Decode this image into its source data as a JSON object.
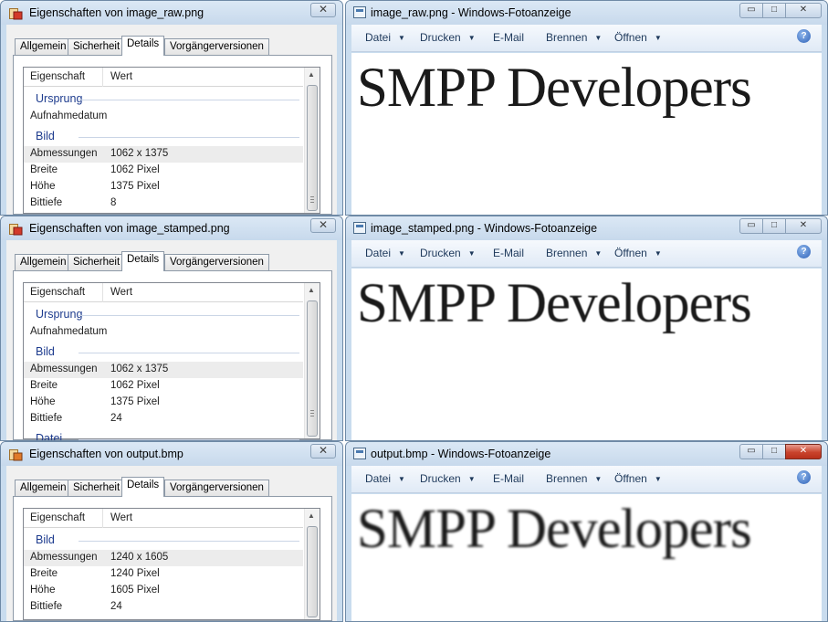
{
  "properties_windows": [
    {
      "title": "Eigenschaften von image_raw.png",
      "close_label": "✕",
      "tabs": [
        "Allgemein",
        "Sicherheit",
        "Details",
        "Vorgängerversionen"
      ],
      "active_tab": "Details",
      "columns": [
        "Eigenschaft",
        "Wert"
      ],
      "groups": [
        {
          "name": "Ursprung",
          "rows": [
            {
              "key": "Aufnahmedatum",
              "value": ""
            }
          ]
        },
        {
          "name": "Bild",
          "rows": [
            {
              "key": "Abmessungen",
              "value": "1062 x 1375"
            },
            {
              "key": "Breite",
              "value": "1062 Pixel"
            },
            {
              "key": "Höhe",
              "value": "1375 Pixel"
            },
            {
              "key": "Bittiefe",
              "value": "8"
            }
          ]
        }
      ]
    },
    {
      "title": "Eigenschaften von image_stamped.png",
      "close_label": "✕",
      "tabs": [
        "Allgemein",
        "Sicherheit",
        "Details",
        "Vorgängerversionen"
      ],
      "active_tab": "Details",
      "columns": [
        "Eigenschaft",
        "Wert"
      ],
      "groups": [
        {
          "name": "Ursprung",
          "rows": [
            {
              "key": "Aufnahmedatum",
              "value": ""
            }
          ]
        },
        {
          "name": "Bild",
          "rows": [
            {
              "key": "Abmessungen",
              "value": "1062 x 1375"
            },
            {
              "key": "Breite",
              "value": "1062 Pixel"
            },
            {
              "key": "Höhe",
              "value": "1375 Pixel"
            },
            {
              "key": "Bittiefe",
              "value": "24"
            }
          ]
        },
        {
          "name": "Datei",
          "rows": []
        }
      ]
    },
    {
      "title": "Eigenschaften von output.bmp",
      "close_label": "✕",
      "tabs": [
        "Allgemein",
        "Sicherheit",
        "Details",
        "Vorgängerversionen"
      ],
      "active_tab": "Details",
      "columns": [
        "Eigenschaft",
        "Wert"
      ],
      "groups": [
        {
          "name": "Bild",
          "rows": [
            {
              "key": "Abmessungen",
              "value": "1240 x 1605"
            },
            {
              "key": "Breite",
              "value": "1240 Pixel"
            },
            {
              "key": "Höhe",
              "value": "1605 Pixel"
            },
            {
              "key": "Bittiefe",
              "value": "24"
            }
          ]
        }
      ]
    }
  ],
  "viewer_windows": [
    {
      "title": "image_raw.png - Windows-Fotoanzeige",
      "menu": [
        "Datei",
        "Drucken",
        "E-Mail",
        "Brennen",
        "Öffnen"
      ],
      "menu_has_caret": [
        true,
        true,
        false,
        true,
        true
      ],
      "help_label": "?",
      "image_text": "SMPP Developers",
      "active": false
    },
    {
      "title": "image_stamped.png - Windows-Fotoanzeige",
      "menu": [
        "Datei",
        "Drucken",
        "E-Mail",
        "Brennen",
        "Öffnen"
      ],
      "menu_has_caret": [
        true,
        true,
        false,
        true,
        true
      ],
      "help_label": "?",
      "image_text": "SMPP Developers",
      "active": false
    },
    {
      "title": "output.bmp - Windows-Fotoanzeige",
      "menu": [
        "Datei",
        "Drucken",
        "E-Mail",
        "Brennen",
        "Öffnen"
      ],
      "menu_has_caret": [
        true,
        true,
        false,
        true,
        true
      ],
      "help_label": "?",
      "image_text": "SMPP Developers",
      "active": true
    }
  ],
  "window_buttons": {
    "minimize": "▭",
    "maximize": "□",
    "close": "✕"
  },
  "colors": {
    "chrome": "#c9dcee",
    "group_heading": "#1e3c8e",
    "menu_text": "#1e395b",
    "close_active": "#c9432c"
  }
}
